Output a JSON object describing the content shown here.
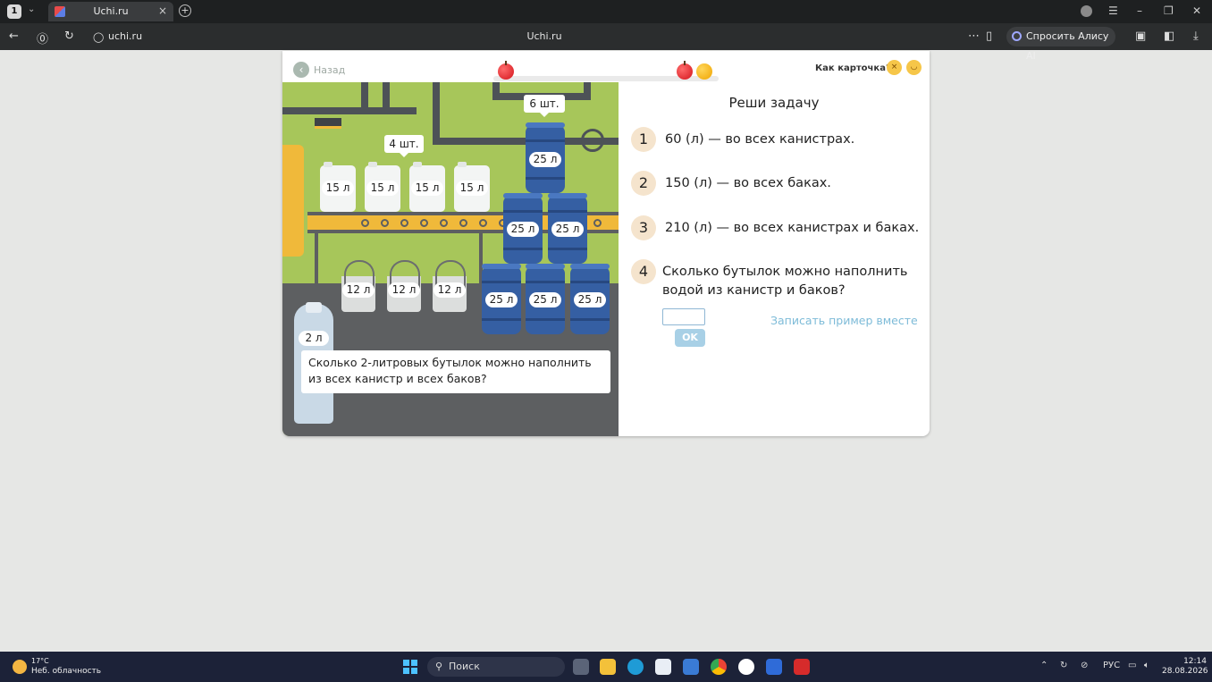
{
  "browser": {
    "tab_count": "1",
    "tab_title": "Uchi.ru",
    "url_host": "uchi.ru",
    "page_title": "Uchi.ru",
    "alice_label": "Спросить Алису AI"
  },
  "card": {
    "back_label": "Назад",
    "feedback_label": "Как карточка?"
  },
  "scene": {
    "canister_group_label": "4 шт.",
    "barrel_group_label": "6 шт.",
    "canister_volume": "15 л",
    "barrel_volume": "25 л",
    "bucket_volume": "12 л",
    "bottle_volume": "2 л",
    "question": "Сколько 2-литровых бутылок можно наполнить из всех канистр и всех баков?"
  },
  "task": {
    "title": "Реши задачу",
    "steps": [
      {
        "num": "1",
        "text": "60 (л) — во всех канистрах."
      },
      {
        "num": "2",
        "text": "150 (л) — во всех баках."
      },
      {
        "num": "3",
        "text": "210 (л) — во всех канистрах и баках."
      },
      {
        "num": "4",
        "text": "Сколько бутылок можно наполнить водой из канистр и баков?"
      }
    ],
    "answer_value": "",
    "ok_label": "OK",
    "together_link": "Записать пример вместе"
  },
  "taskbar": {
    "temperature": "17°C",
    "weather": "Неб. облачность",
    "search_placeholder": "Поиск",
    "language": "РУС",
    "time": "12:14",
    "date": "28.08.2026"
  },
  "colors": {
    "scene_green": "#a7c65a",
    "barrel_blue": "#355fa3",
    "belt_yellow": "#f0b93a",
    "link_blue": "#7dbbd8"
  }
}
